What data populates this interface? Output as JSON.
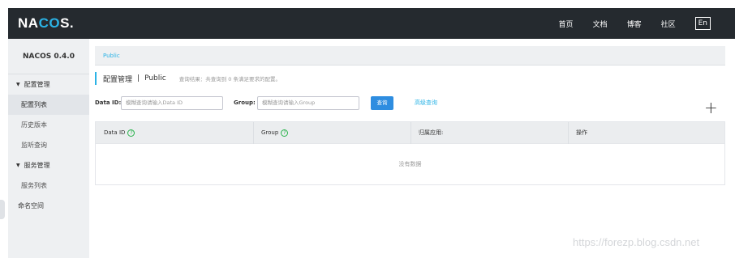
{
  "header": {
    "logo_main": "NA",
    "logo_accent": "CO",
    "logo_end": "S.",
    "nav": [
      "首页",
      "文档",
      "博客",
      "社区"
    ],
    "lang": "En"
  },
  "sidebar": {
    "title": "NACOS 0.4.0",
    "groups": [
      {
        "label": "配置管理",
        "items": [
          "配置列表",
          "历史版本",
          "监听查询"
        ]
      },
      {
        "label": "服务管理",
        "items": [
          "服务列表"
        ]
      }
    ],
    "extra_item": "命名空间"
  },
  "breadcrumb": "Public",
  "page_header": {
    "title": "配置管理",
    "separator": "|",
    "namespace": "Public",
    "info": "查询结果：共查询到 0 条满足要求的配置。"
  },
  "search": {
    "dataid_label": "Data ID:",
    "dataid_placeholder": "模糊查询请输入Data ID",
    "group_label": "Group:",
    "group_placeholder": "模糊查询请输入Group",
    "query_button": "查询",
    "advanced_link": "高级查询",
    "add_symbol": "+"
  },
  "table": {
    "columns": [
      "Data ID",
      "Group",
      "归属应用:",
      "操作"
    ],
    "help_symbol": "?",
    "empty_text": "没有数据"
  },
  "watermark": "https://forezp.blog.csdn.net",
  "colors": {
    "topbar": "#252a2f",
    "accent": "#2bb3e6",
    "primary_button": "#2e8de0",
    "help_icon": "#27b24a"
  }
}
